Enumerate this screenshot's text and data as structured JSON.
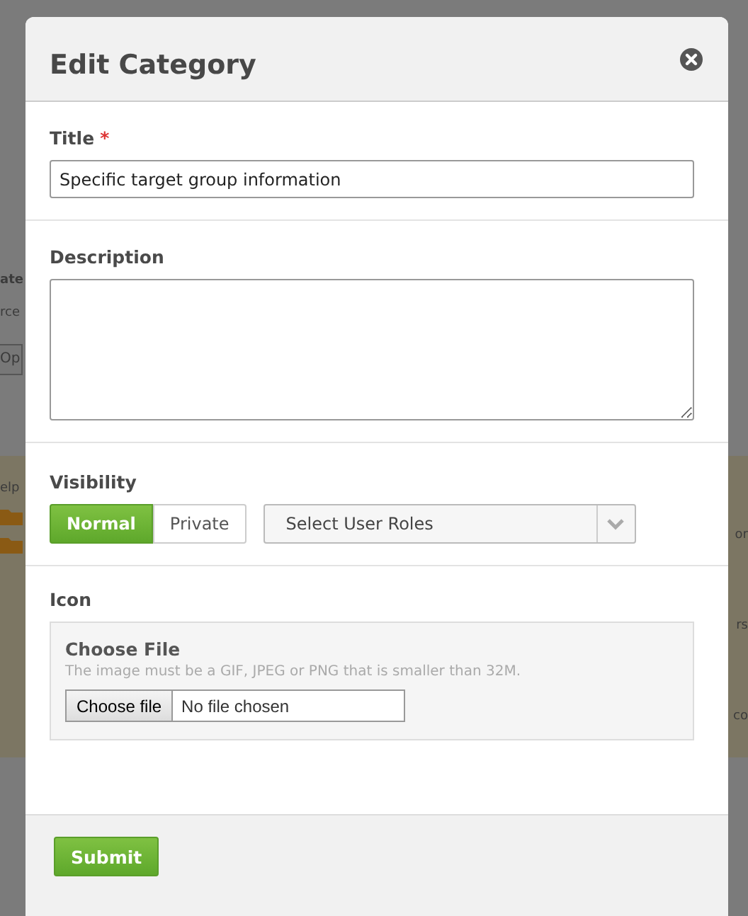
{
  "background": {
    "left": [
      {
        "kind": "heading",
        "text": "ate"
      },
      {
        "kind": "text",
        "text": "rce"
      },
      {
        "kind": "button",
        "text": "Op"
      },
      {
        "kind": "text",
        "text": "elp"
      }
    ],
    "right": [
      "or",
      "rs",
      "co"
    ]
  },
  "dialog": {
    "title": "Edit Category"
  },
  "title_field": {
    "label": "Title",
    "required_mark": "*",
    "value": "Specific target group information"
  },
  "description_field": {
    "label": "Description"
  },
  "visibility": {
    "label": "Visibility",
    "options": [
      {
        "label": "Normal",
        "selected": true
      },
      {
        "label": "Private",
        "selected": false
      }
    ],
    "roles": {
      "placeholder": "Select User Roles"
    }
  },
  "icon": {
    "label": "Icon",
    "heading": "Choose File",
    "hint": "The image must be a GIF, JPEG or PNG that is smaller than 32M.",
    "button": "Choose file",
    "status": "No file chosen"
  },
  "footer": {
    "submit": "Submit"
  }
}
